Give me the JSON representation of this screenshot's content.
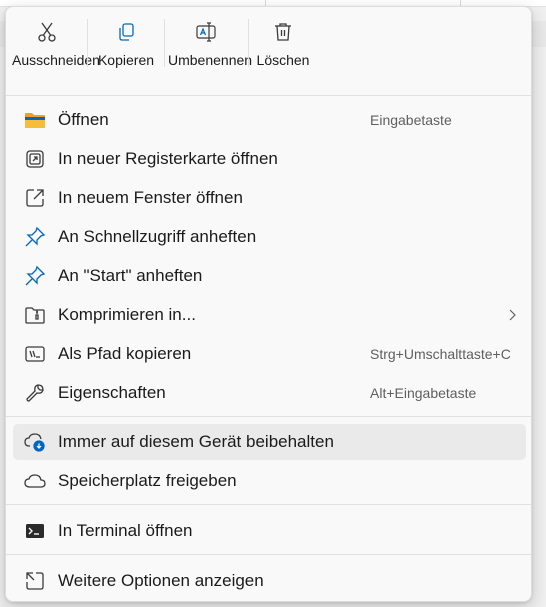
{
  "toolbar": {
    "cut_label": "Ausschneiden",
    "copy_label": "Kopieren",
    "rename_label": "Umbenennen",
    "delete_label": "Löschen"
  },
  "items": [
    {
      "label": "Öffnen",
      "shortcut": "Eingabetaste",
      "icon": "folder-icon"
    },
    {
      "label": "In neuer Registerkarte öffnen",
      "shortcut": "",
      "icon": "open-in-new-tab-icon"
    },
    {
      "label": "In neuem Fenster öffnen",
      "shortcut": "",
      "icon": "open-in-new-window-icon"
    },
    {
      "label": "An Schnellzugriff anheften",
      "shortcut": "",
      "icon": "pin-icon"
    },
    {
      "label": "An \"Start\" anheften",
      "shortcut": "",
      "icon": "pin-icon"
    },
    {
      "label": "Komprimieren in...",
      "shortcut": "",
      "icon": "zip-folder-icon"
    },
    {
      "label": "Als Pfad kopieren",
      "shortcut": "Strg+Umschalttaste+C",
      "icon": "copy-path-icon"
    },
    {
      "label": "Eigenschaften",
      "shortcut": "Alt+Eingabetaste",
      "icon": "wrench-icon"
    },
    {
      "label": "Immer auf diesem Gerät beibehalten",
      "shortcut": "",
      "icon": "cloud-pin-icon"
    },
    {
      "label": "Speicherplatz freigeben",
      "shortcut": "",
      "icon": "cloud-icon"
    },
    {
      "label": "In Terminal öffnen",
      "shortcut": "",
      "icon": "terminal-icon"
    },
    {
      "label": "Weitere Optionen anzeigen",
      "shortcut": "",
      "icon": "more-options-icon"
    }
  ],
  "colors": {
    "accent": "#0067c0",
    "folder": "#f4b731",
    "terminal": "#2b2b2b"
  }
}
